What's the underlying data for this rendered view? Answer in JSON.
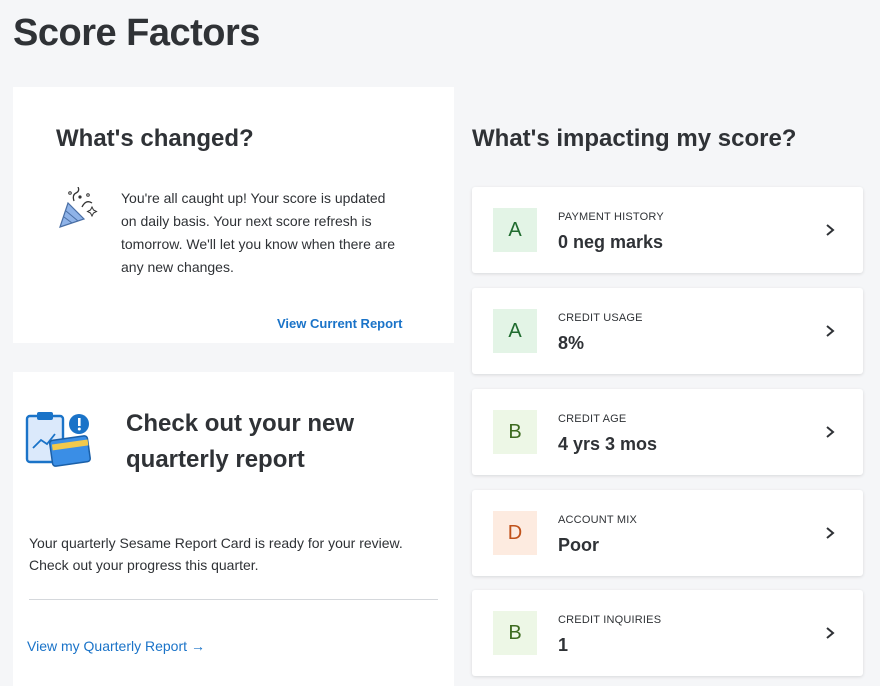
{
  "page": {
    "title": "Score Factors"
  },
  "changed": {
    "heading": "What's changed?",
    "message": "You're all caught up! Your score is updated on daily basis. Your next score refresh is tomorrow. We'll let you know when there are any new changes.",
    "link_label": "View Current Report",
    "icon": "party-popper-icon"
  },
  "quarterly": {
    "heading": "Check out your new quarterly report",
    "message": "Your quarterly Sesame Report Card is ready for your review. Check out your progress this quarter.",
    "link_label": "View my Quarterly Report",
    "link_arrow": "→",
    "icon": "report-card-icon"
  },
  "impact": {
    "heading": "What's impacting my score?",
    "factors": [
      {
        "label": "PAYMENT HISTORY",
        "value": "0 neg marks",
        "grade": "A",
        "grade_bg": "#e3f4e6",
        "grade_color": "#1f6b2e"
      },
      {
        "label": "CREDIT USAGE",
        "value": "8%",
        "grade": "A",
        "grade_bg": "#e3f4e6",
        "grade_color": "#1f6b2e"
      },
      {
        "label": "CREDIT AGE",
        "value": "4 yrs 3 mos",
        "grade": "B",
        "grade_bg": "#edf7e6",
        "grade_color": "#3d6b1f"
      },
      {
        "label": "ACCOUNT MIX",
        "value": "Poor",
        "grade": "D",
        "grade_bg": "#fdebe0",
        "grade_color": "#c0521a"
      },
      {
        "label": "CREDIT INQUIRIES",
        "value": "1",
        "grade": "B",
        "grade_bg": "#edf7e6",
        "grade_color": "#3d6b1f"
      }
    ]
  },
  "colors": {
    "link": "#1a73c8",
    "background": "#f5f6f8"
  }
}
